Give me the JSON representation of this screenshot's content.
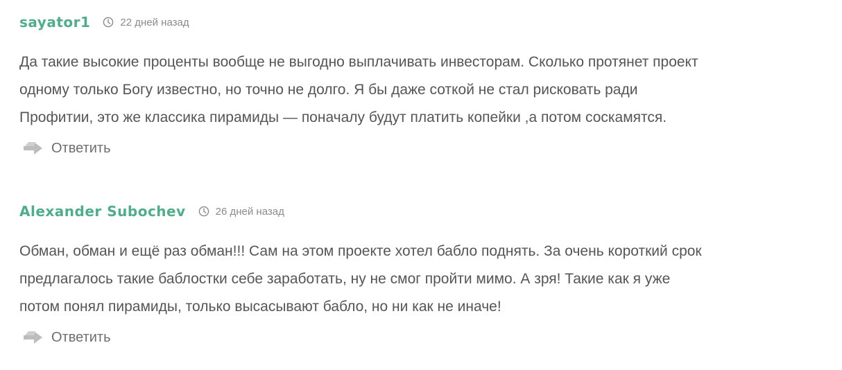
{
  "comments": [
    {
      "author": "sayator1",
      "time": "22 дней назад",
      "text_lines": [
        "Да такие высокие проценты вообще не выгодно выплачивать инвесторам. Сколько протянет проект",
        "одному только Богу известно, но точно не долго. Я бы даже соткой не стал рисковать ради",
        "Профитии, это же классика пирамиды — поначалу будут платить копейки ,а потом соскамятся."
      ],
      "reply_label": "Ответить"
    },
    {
      "author": "Alexander Subochev",
      "time": "26 дней назад",
      "text_lines": [
        "Обман, обман и ещё раз обман!!! Сам на этом проекте хотел бабло поднять. За очень короткий срок",
        "предлагалось такие баблостки себе заработать, ну не смог пройти мимо. А зря! Такие как я уже",
        "потом понял пирамиды, только высасывают бабло, но ни как не иначе!"
      ],
      "reply_label": "Ответить"
    }
  ],
  "icons": {
    "time": "clock-icon",
    "reply": "reply-arrow-icon"
  },
  "colors": {
    "author": "#4fae8a",
    "text": "#555555",
    "meta": "#8a8a8a",
    "reply_icon": "#bdbdbd"
  }
}
